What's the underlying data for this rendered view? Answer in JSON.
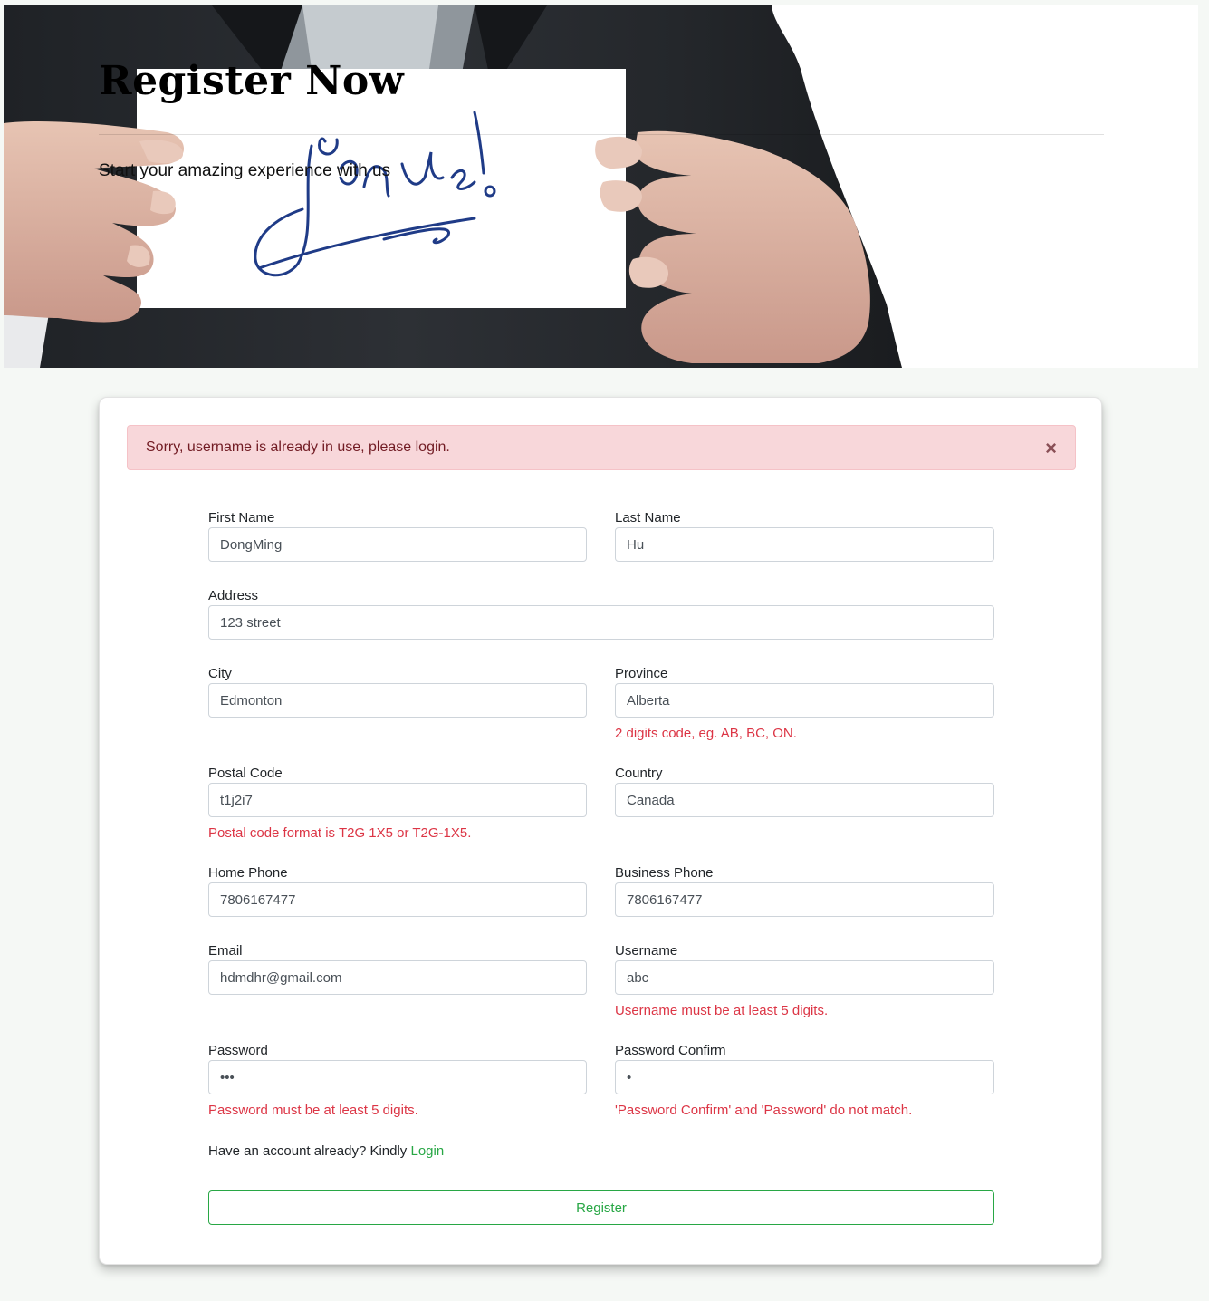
{
  "hero": {
    "title": "Register Now",
    "subtitle": "Start your amazing experience with us",
    "image_alt": "Join us!"
  },
  "alert": {
    "message": "Sorry, username is already in use, please login.",
    "close_symbol": "×",
    "color": "#f8d7da"
  },
  "form": {
    "first_name": {
      "label": "First Name",
      "value": "DongMing"
    },
    "last_name": {
      "label": "Last Name",
      "value": "Hu"
    },
    "address": {
      "label": "Address",
      "value": "123 street"
    },
    "city": {
      "label": "City",
      "value": "Edmonton"
    },
    "province": {
      "label": "Province",
      "value": "Alberta",
      "error": "2 digits code, eg. AB, BC, ON."
    },
    "postal_code": {
      "label": "Postal Code",
      "value": "t1j2i7",
      "error": "Postal code format is T2G 1X5 or T2G-1X5."
    },
    "country": {
      "label": "Country",
      "value": "Canada"
    },
    "home_phone": {
      "label": "Home Phone",
      "value": "7806167477"
    },
    "business_phone": {
      "label": "Business Phone",
      "value": "7806167477"
    },
    "email": {
      "label": "Email",
      "value": "hdmdhr@gmail.com"
    },
    "username": {
      "label": "Username",
      "value": "abc",
      "error": "Username must be at least 5 digits."
    },
    "password": {
      "label": "Password",
      "value": "abc",
      "error": "Password must be at least 5 digits."
    },
    "password_confirm": {
      "label": "Password Confirm",
      "value": "a",
      "error": "'Password Confirm' and 'Password' do not match."
    }
  },
  "login_prompt": {
    "text": "Have an account already? Kindly ",
    "link_label": "Login"
  },
  "register_button": {
    "label": "Register"
  },
  "colors": {
    "error": "#dc3545",
    "success": "#28a745",
    "page_bg": "#f5f8f5"
  }
}
